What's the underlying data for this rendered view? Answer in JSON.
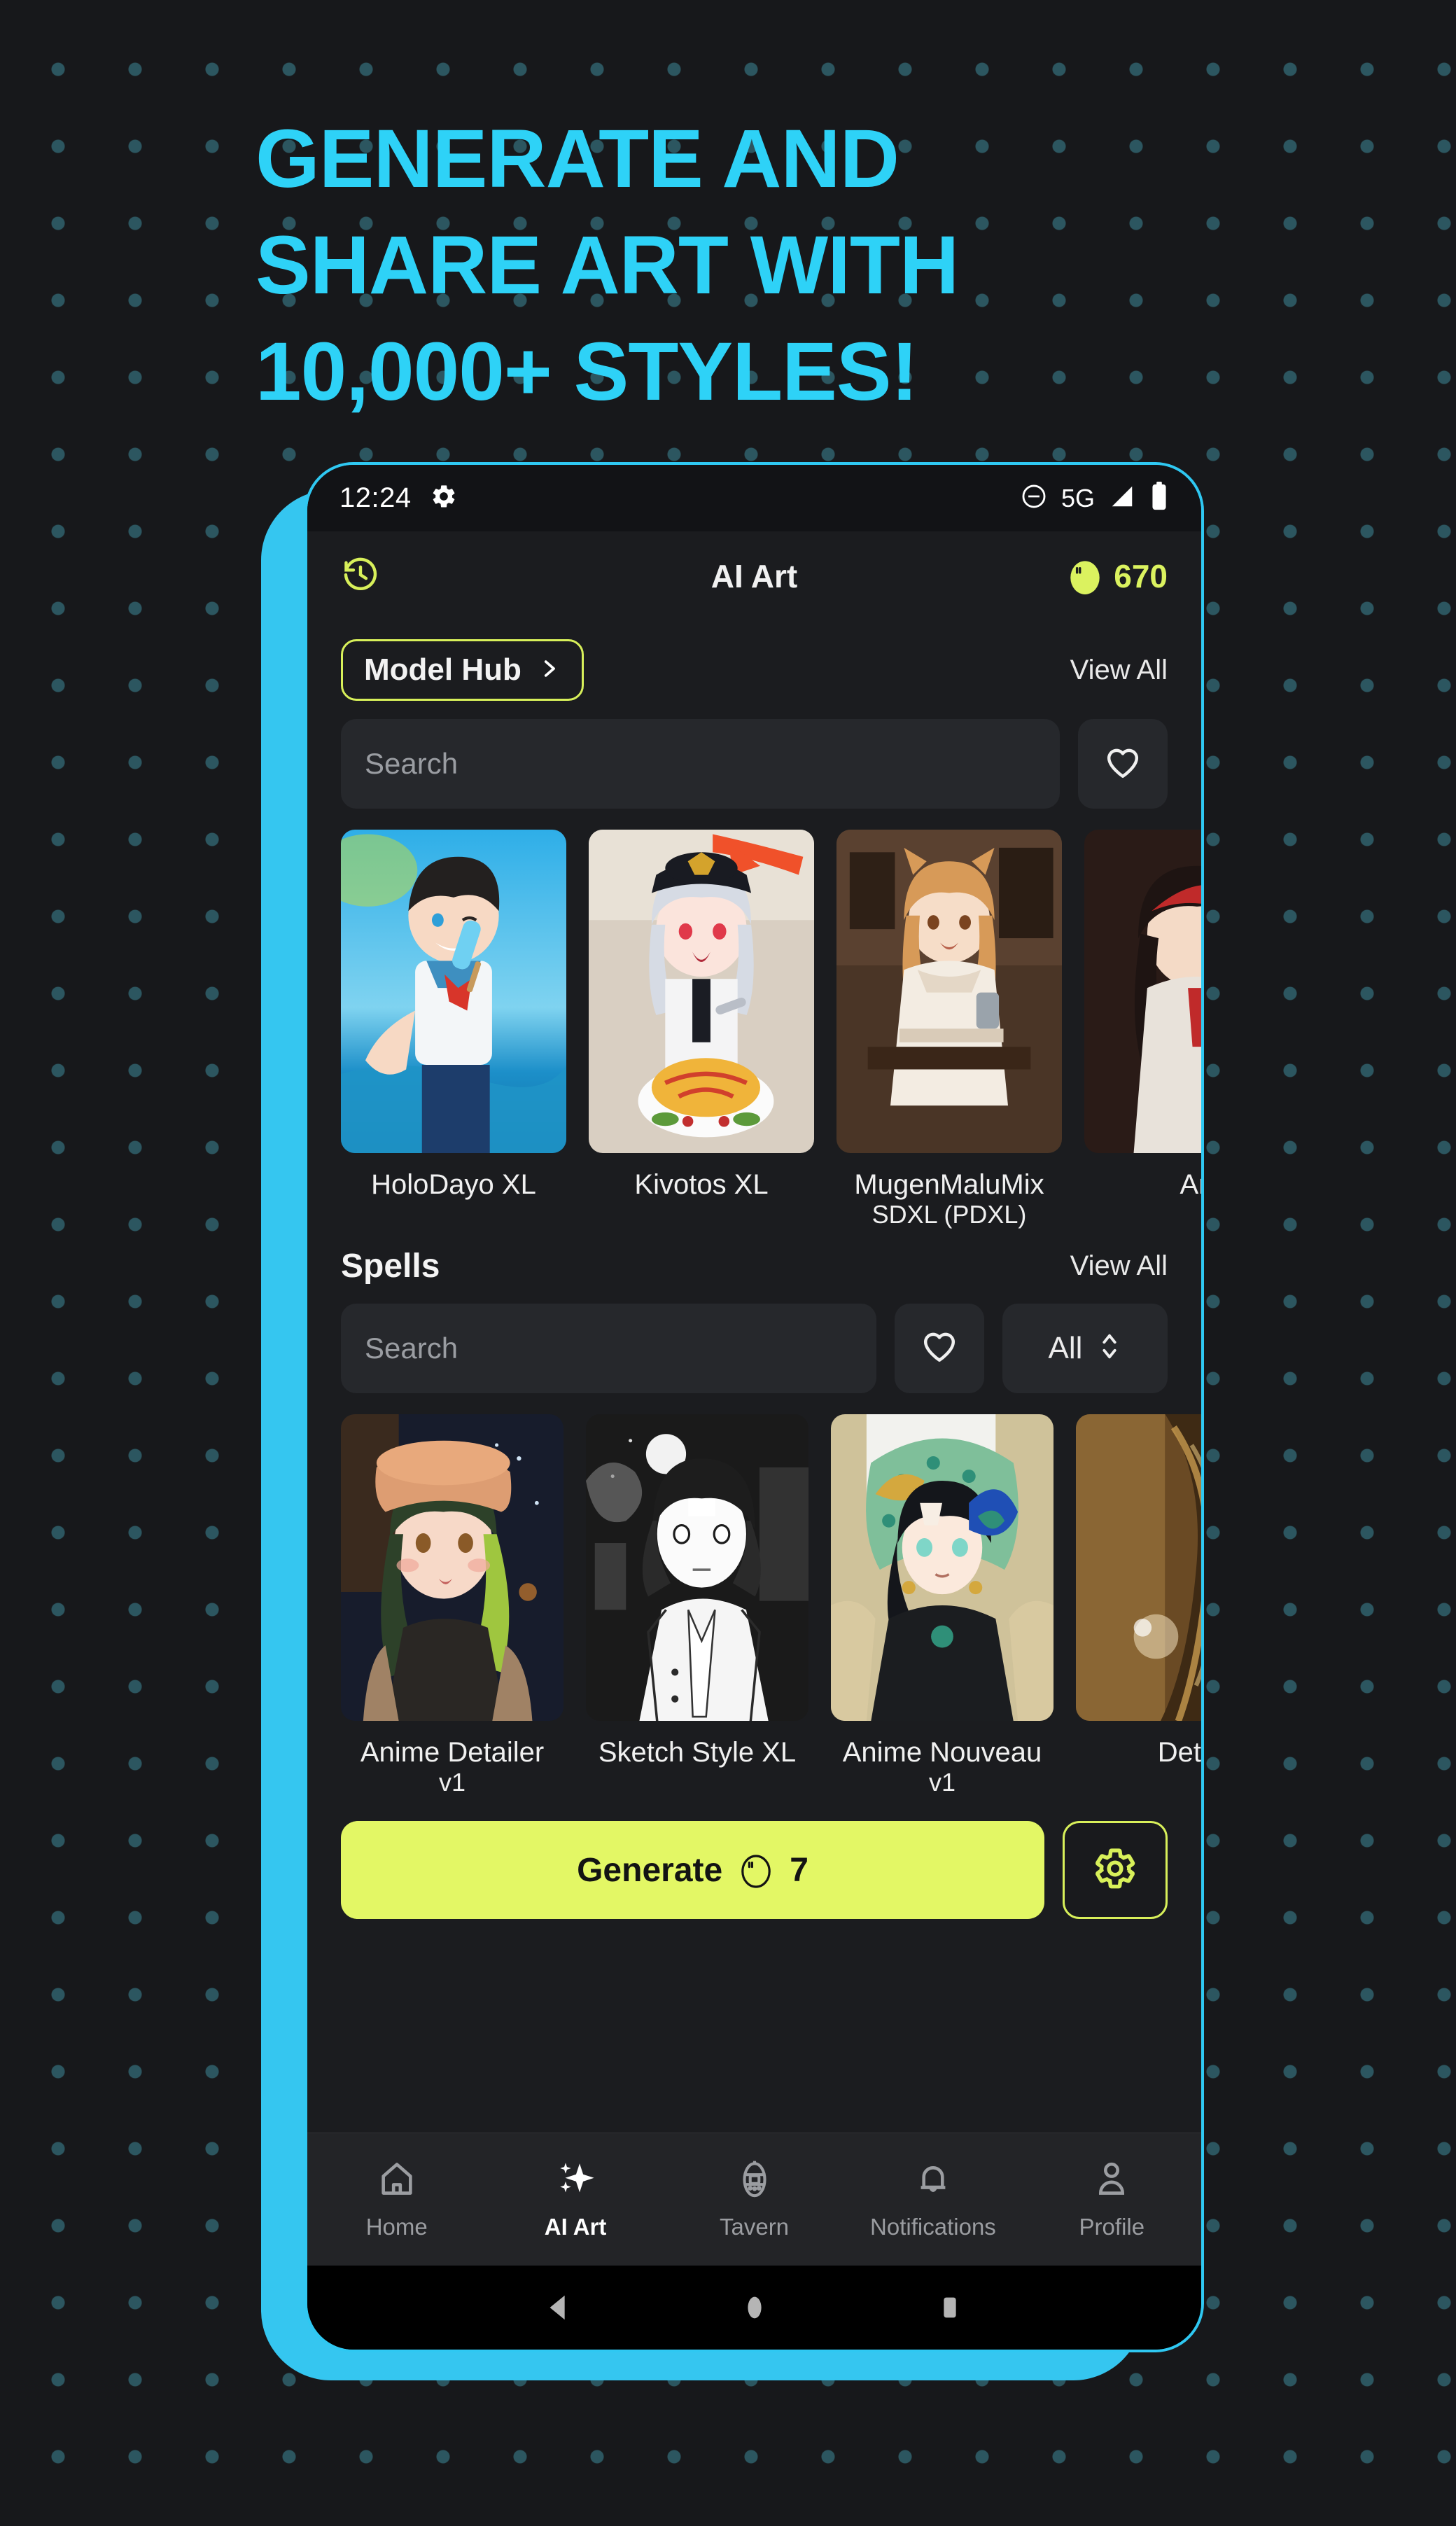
{
  "promo": {
    "headline_lines": [
      "GENERATE AND",
      "SHARE ART WITH",
      "10,000+ STYLES!"
    ],
    "accent_color": "#2ED2F7",
    "background_color": "#17181b",
    "dot_color": "#2c5660"
  },
  "status_bar": {
    "time": "12:24",
    "gear_icon": "gear-icon",
    "dnd_icon": "do-not-disturb-icon",
    "network": "5G",
    "signal_icon": "signal-icon",
    "battery_icon": "battery-icon"
  },
  "app_header": {
    "history_icon": "history-icon",
    "title": "AI Art",
    "coin_icon": "egg-coin-icon",
    "coin_count": "670",
    "coin_color": "#DBF25F"
  },
  "model_section": {
    "hub_button_label": "Model Hub",
    "hub_chevron_icon": "chevron-right-icon",
    "view_all_label": "View All",
    "search_placeholder": "Search",
    "favorite_icon": "heart-icon",
    "cards": [
      {
        "name": "HoloDayo XL",
        "sub": ""
      },
      {
        "name": "Kivotos XL",
        "sub": ""
      },
      {
        "name": "MugenMaluMix",
        "sub": "SDXL (PDXL)"
      },
      {
        "name": "An",
        "sub": ""
      }
    ]
  },
  "spells_section": {
    "title": "Spells",
    "view_all_label": "View All",
    "search_placeholder": "Search",
    "favorite_icon": "heart-icon",
    "filter_value": "All",
    "filter_icon": "chevron-updown-icon",
    "cards": [
      {
        "name": "Anime Detailer",
        "sub": "v1"
      },
      {
        "name": "Sketch Style XL",
        "sub": ""
      },
      {
        "name": "Anime Nouveau",
        "sub": "v1"
      },
      {
        "name": "Deta",
        "sub": ""
      }
    ]
  },
  "generate": {
    "label": "Generate",
    "cost_icon": "egg-coin-icon",
    "cost": "7",
    "button_color": "#E3F765",
    "settings_icon": "gear-icon"
  },
  "bottom_nav": {
    "items": [
      {
        "label": "Home",
        "icon": "home-icon",
        "active": false
      },
      {
        "label": "AI Art",
        "icon": "sparkles-icon",
        "active": true
      },
      {
        "label": "Tavern",
        "icon": "tavern-icon",
        "active": false
      },
      {
        "label": "Notifications",
        "icon": "bell-icon",
        "active": false
      },
      {
        "label": "Profile",
        "icon": "person-icon",
        "active": false
      }
    ]
  },
  "system_nav": {
    "back_icon": "back-triangle-icon",
    "home_icon": "home-circle-icon",
    "recents_icon": "recents-square-icon"
  }
}
